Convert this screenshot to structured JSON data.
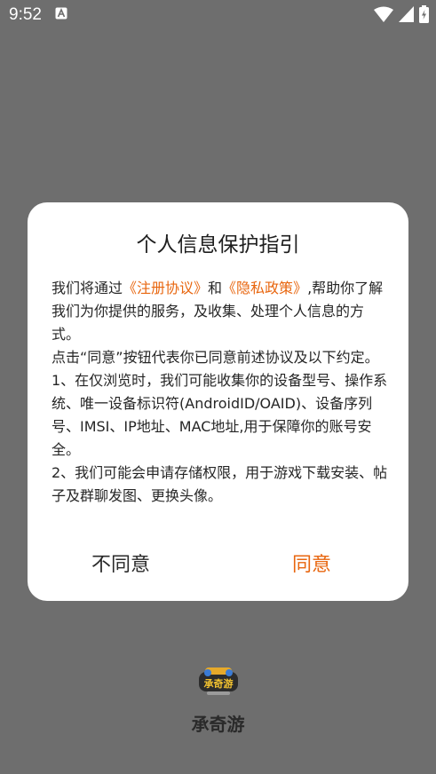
{
  "status_bar": {
    "time": "9:52",
    "icons": [
      "notification-a-icon",
      "wifi-icon",
      "signal-icon",
      "battery-icon"
    ]
  },
  "dialog": {
    "title": "个人信息保护指引",
    "p1_before": "我们将通过",
    "link_register": "《注册协议》",
    "p1_and": "和",
    "link_privacy": "《隐私政策》",
    "p1_after": ",帮助你了解我们为你提供的服务，及收集、处理个人信息的方式。",
    "p2": "点击“同意”按钮代表你已同意前述协议及以下约定。",
    "p3": "1、在仅浏览时，我们可能收集你的设备型号、操作系统、唯一设备标识符(AndroidID/OAID)、设备序列号、IMSI、IP地址、MAC地址,用于保障你的账号安全。",
    "p4": "2、我们可能会申请存储权限，用于游戏下载安装、帖子及群聊发图、更换头像。",
    "disagree_label": "不同意",
    "agree_label": "同意"
  },
  "app": {
    "name": "承奇游",
    "logo_text": "承奇游"
  },
  "colors": {
    "accent": "#e8660f",
    "overlay": "#6e6e6e",
    "dialog_bg": "#ffffff"
  }
}
